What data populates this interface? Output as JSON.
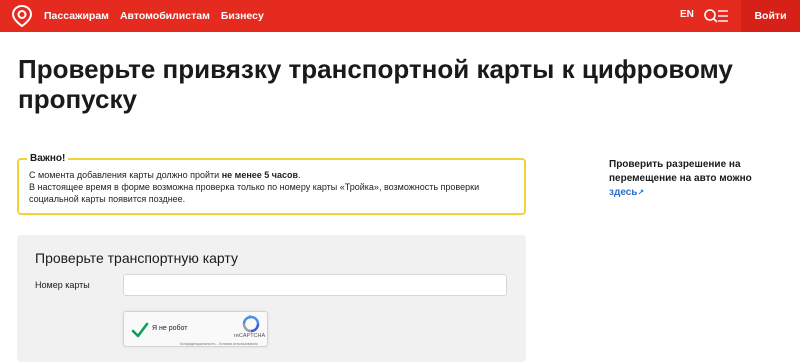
{
  "header": {
    "nav": [
      "Пассажирам",
      "Автомобилистам",
      "Бизнесу"
    ],
    "lang": "EN",
    "login_label": "Войти"
  },
  "page": {
    "title": "Проверьте привязку транспортной карты к цифровому пропуску"
  },
  "notice": {
    "title": "Важно!",
    "line1_prefix": "С момента добавления карты должно пройти ",
    "line1_bold": "не менее 5 часов",
    "line1_suffix": ".",
    "line2": "В настоящее время в форме возможна проверка только по номеру карты «Тройка», возможность проверки социальной карты появится позднее."
  },
  "side": {
    "text": "Проверить разрешение на перемещение на авто можно",
    "link": "здесь",
    "link_arrow": "↗"
  },
  "form": {
    "title": "Проверьте транспортную карту",
    "card_label": "Номер карты",
    "card_value": "",
    "card_placeholder": ""
  },
  "captcha": {
    "label": "Я не робот",
    "brand": "reCAPTCHA",
    "links": "Конфиденциальность - Условия использования"
  },
  "colors": {
    "brand_red": "#e52b1f",
    "login_bg": "#d62118",
    "notice_border": "#f2d335",
    "link": "#2a6fc9",
    "form_bg": "#f1f1f1"
  }
}
